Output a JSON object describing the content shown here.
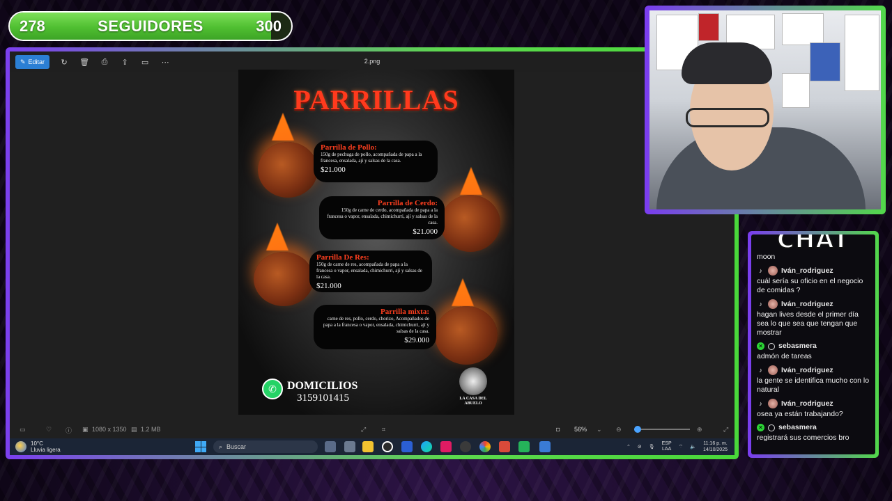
{
  "follower_goal": {
    "current": "278",
    "label": "SEGUIDORES",
    "goal": "300",
    "progress": 0.927
  },
  "viewer": {
    "edit_label": "Editar",
    "file_name": "2.png",
    "toolbar_icons": [
      "rotate-icon",
      "delete-icon",
      "print-icon",
      "share-icon",
      "slideshow-icon",
      "more-icon"
    ],
    "status": {
      "dimensions": "1080 x 1350",
      "size": "1.2 MB",
      "zoom": "56%"
    }
  },
  "poster": {
    "title": "PARRILLAS",
    "items": [
      {
        "name": "Parrilla de Pollo:",
        "desc": "150g de pechuga de pollo, acompañada de papa a la francesa, ensalada, ají y salsas de la casa.",
        "price": "$21.000"
      },
      {
        "name": "Parrilla de Cerdo:",
        "desc": "150g de carne de cerdo, acompañada de papa a la francesa o vapor, ensalada, chimichurri, ají y salsas de la casa.",
        "price": "$21.000"
      },
      {
        "name": "Parrilla De Res:",
        "desc": "150g de carne de res, acompañada de papa a la francesa o vapor, ensalada, chimichurri, ají y salsas de la casa.",
        "price": "$21.000"
      },
      {
        "name": "Parrilla mixta:",
        "desc": "carne de res, pollo, cerdo, chorizo, Acompañados de papa a la francesa o vapor, ensalada, chimichurri, ají y salsas de la casa.",
        "price": "$29.000"
      }
    ],
    "delivery_label": "DOMICILIOS",
    "delivery_phone": "3159101415",
    "logo_text": "LA CASA DEL ABUELO"
  },
  "taskbar": {
    "weather_temp": "10°C",
    "weather_desc": "Lluvia ligera",
    "search_placeholder": "Buscar",
    "language": "ESP",
    "language_sub": "LAA",
    "time": "11:16 p. m.",
    "date": "14/10/2025"
  },
  "chat": {
    "title": "CHAT",
    "first_line": "moon",
    "messages": [
      {
        "platform": "tiktok",
        "user": "Iván_rodriguez",
        "text": "cuál sería su oficio en el negocio de comidas ?"
      },
      {
        "platform": "tiktok",
        "user": "Iván_rodriguez",
        "text": "hagan lives desde el primer día sea lo que sea que tengan que mostrar"
      },
      {
        "platform": "kick",
        "user": "sebasmera",
        "text": "admón de tareas"
      },
      {
        "platform": "tiktok",
        "user": "Iván_rodriguez",
        "text": "la gente se identifica mucho con lo natural"
      },
      {
        "platform": "tiktok",
        "user": "Iván_rodriguez",
        "text": "osea ya están trabajando?"
      },
      {
        "platform": "kick",
        "user": "sebasmera",
        "text": "registrará sus comercios bro"
      }
    ]
  },
  "colors": {
    "accent_green": "#4fbf31",
    "accent_purple": "#7a3cf0",
    "poster_red": "#ff3a1d",
    "edit_blue": "#2b7fd4"
  }
}
